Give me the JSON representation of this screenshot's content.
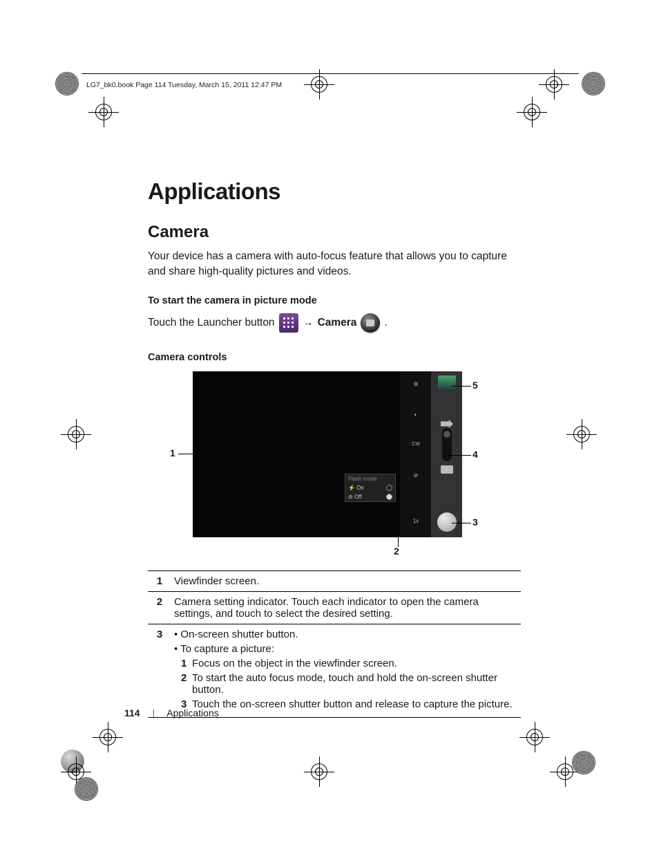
{
  "headerLine": "LG7_bk0.book  Page 114  Tuesday, March 15, 2011  12:47 PM",
  "title": "Applications",
  "section": "Camera",
  "intro": "Your device has a camera with auto-focus feature that allows you to capture and share high-quality pictures and videos.",
  "startHead": "To start the camera in picture mode",
  "launchPrefix": "Touch the Launcher button",
  "launchArrow": "→",
  "launchCamera": "Camera",
  "launchSuffix": ".",
  "controlsHead": "Camera controls",
  "popup": {
    "title": "Flash mode",
    "row1": {
      "icon": "⚡",
      "label": "On"
    },
    "row2": {
      "icon": "⊘",
      "label": "Off"
    }
  },
  "sidebar": {
    "cw": "CW",
    "zoom": "1x"
  },
  "callouts": {
    "c1": "1",
    "c2": "2",
    "c3": "3",
    "c4": "4",
    "c5": "5"
  },
  "table": {
    "r1": {
      "n": "1",
      "text": "Viewfinder screen."
    },
    "r2": {
      "n": "2",
      "text": "Camera setting indicator. Touch each indicator to open the camera settings, and touch to select the desired setting."
    },
    "r3": {
      "n": "3",
      "b1": "On-screen shutter button.",
      "b2": "To capture a picture:",
      "s1": {
        "n": "1",
        "t": "Focus on the object in the viewfinder screen."
      },
      "s2": {
        "n": "2",
        "t": "To start the auto focus mode, touch and hold the on-screen shutter button."
      },
      "s3": {
        "n": "3",
        "t": "Touch the on-screen shutter button and release to capture the picture."
      }
    }
  },
  "footer": {
    "page": "114",
    "section": "Applications"
  }
}
